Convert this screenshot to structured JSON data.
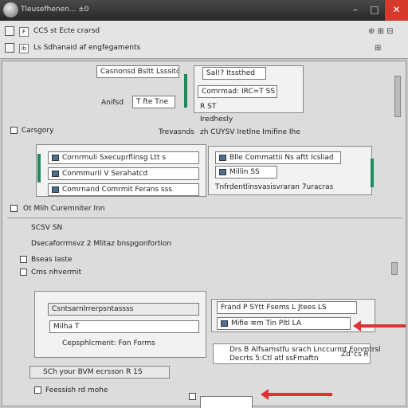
{
  "window": {
    "title": "Tleusefhenen... ±0",
    "min": "–",
    "max": "□",
    "close": "✕"
  },
  "toolbar": {
    "row1": {
      "code": "F",
      "text": "CCS   st Ecte crarsd",
      "right": "⊕ ⊞ ⊟"
    },
    "row2": {
      "code": "ib",
      "text": "Ls Sdhanaid af engfegaments",
      "right": "⊞"
    }
  },
  "top_section": {
    "combo_label": "Casnonsd Bsltt Lsssitd",
    "row_label_a": "Anifsd",
    "row_label_b": "T fte  Tne",
    "right_title": "Sal!? Itssthed",
    "right_field": "Comrmad:  IRC=T SS",
    "right_list": [
      "R  ST",
      "Iredhesly",
      "zh CUYSV  Iretlne Imifine Ihe"
    ],
    "category_label": "Carsgory",
    "category_value": "Trevasnds"
  },
  "middle_section": {
    "left_items": [
      "Cornrmuli Sxecuprflinsg Ltt s",
      "Conmmuril  V Serahatcd",
      "Comrnand  Comrmit Ferans sss"
    ],
    "right_items": [
      "Blle Commattii  Ns  aftt Icsliad",
      "Millin SS",
      "Tnfrdentlinsvasisvraran 7uracras"
    ]
  },
  "status_row": {
    "label": "Ot  Mlih Curemniter  Inn"
  },
  "section_b": {
    "header": "SCSV  SN",
    "desc": "Dsecaforrmsvz 2  Mlitaz  bnspgonfortion",
    "check_a": "Bseas  Iaste",
    "check_b": "Cms  nhvermit"
  },
  "lower_section": {
    "left_header": "Csntsarnlrrerpsntassss",
    "left_field": "Milha  T",
    "left_caption": "Cepsphlcment:  Fon  Forms",
    "right_header": "Frand  P SYtt  Fsems  L  Jtees  LS",
    "right_field": "Mifie  ≡m Tin Pltl LA",
    "right_box_line1": "Drs  B  Alfsamstfu  srach Lnccurmt  Fonmtrsl",
    "right_box_line2": "Decrts  5:Ctl  atl  ssFmaftn",
    "right_box_side": "Zd\"cs  R"
  },
  "bottom_toolbar": {
    "label": "SCh  your  BVM  ecrsson R 1S"
  },
  "bottom_row": {
    "label": "Feessish  rd  mohe",
    "field": ""
  },
  "colors": {
    "accent_green": "#1f8a5e",
    "arrow_red": "#d33333",
    "close_red": "#d63a2c",
    "selection_blue": "#4a6f99"
  }
}
